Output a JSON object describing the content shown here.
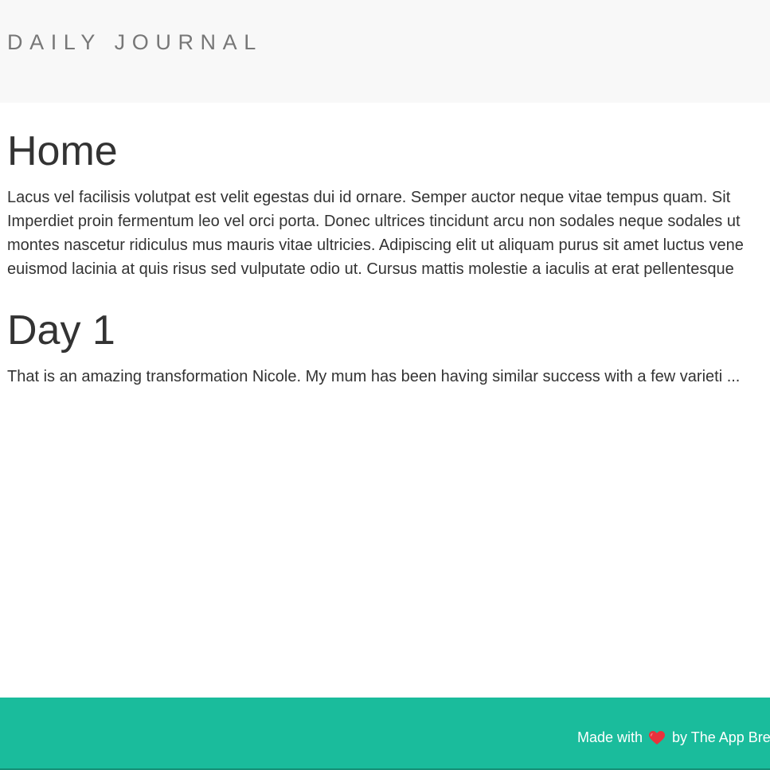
{
  "header": {
    "brand": "DAILY JOURNAL"
  },
  "posts": [
    {
      "title": "Home",
      "lines": [
        "Lacus vel facilisis volutpat est velit egestas dui id ornare. Semper auctor neque vitae tempus quam. Sit",
        "Imperdiet proin fermentum leo vel orci porta. Donec ultrices tincidunt arcu non sodales neque sodales ut",
        "montes nascetur ridiculus mus mauris vitae ultricies. Adipiscing elit ut aliquam purus sit amet luctus vene",
        "euismod lacinia at quis risus sed vulputate odio ut. Cursus mattis molestie a iaculis at erat pellentesque"
      ]
    },
    {
      "title": "Day 1",
      "excerpt": "That is an amazing transformation Nicole. My mum has been having similar success with a few varieti ..."
    }
  ],
  "footer": {
    "made_with": "Made with",
    "heart_icon": "heart-icon",
    "by_text": "by The App Bre"
  },
  "colors": {
    "header_bg": "#f8f8f8",
    "footer_bg": "#1abc9c",
    "heart": "#e8323c"
  }
}
